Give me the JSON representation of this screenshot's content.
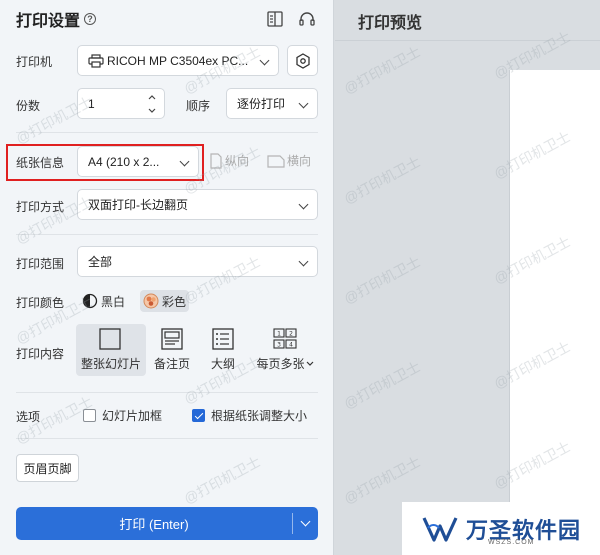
{
  "header": {
    "title": "打印设置",
    "help_icon": "?"
  },
  "printer": {
    "label": "打印机",
    "value": "RICOH MP C3504ex PC..."
  },
  "copies": {
    "label": "份数",
    "value": "1"
  },
  "order": {
    "label": "顺序",
    "value": "逐份打印"
  },
  "paper": {
    "label": "纸张信息",
    "value": "A4 (210 x 2...",
    "portrait": "纵向",
    "landscape": "横向"
  },
  "duplex": {
    "label": "打印方式",
    "value": "双面打印-长边翻页"
  },
  "range": {
    "label": "打印范围",
    "value": "全部"
  },
  "color": {
    "label": "打印颜色",
    "bw": "黑白",
    "color": "彩色",
    "selected": "彩色"
  },
  "content": {
    "label": "打印内容",
    "options": [
      "整张幻灯片",
      "备注页",
      "大纲",
      "每页多张"
    ],
    "selected": "整张幻灯片"
  },
  "options": {
    "label": "选项",
    "frame": "幻灯片加框",
    "frame_checked": false,
    "fit": "根据纸张调整大小",
    "fit_checked": true
  },
  "header_footer_btn": "页眉页脚",
  "print_btn": "打印 (Enter)",
  "preview": {
    "title": "打印预览"
  },
  "watermark": "@打印机卫士",
  "logo": {
    "text": "万圣软件园",
    "sub": "WSZS.COM"
  },
  "colors": {
    "accent": "#2b6fd9",
    "highlight": "#e02020"
  }
}
